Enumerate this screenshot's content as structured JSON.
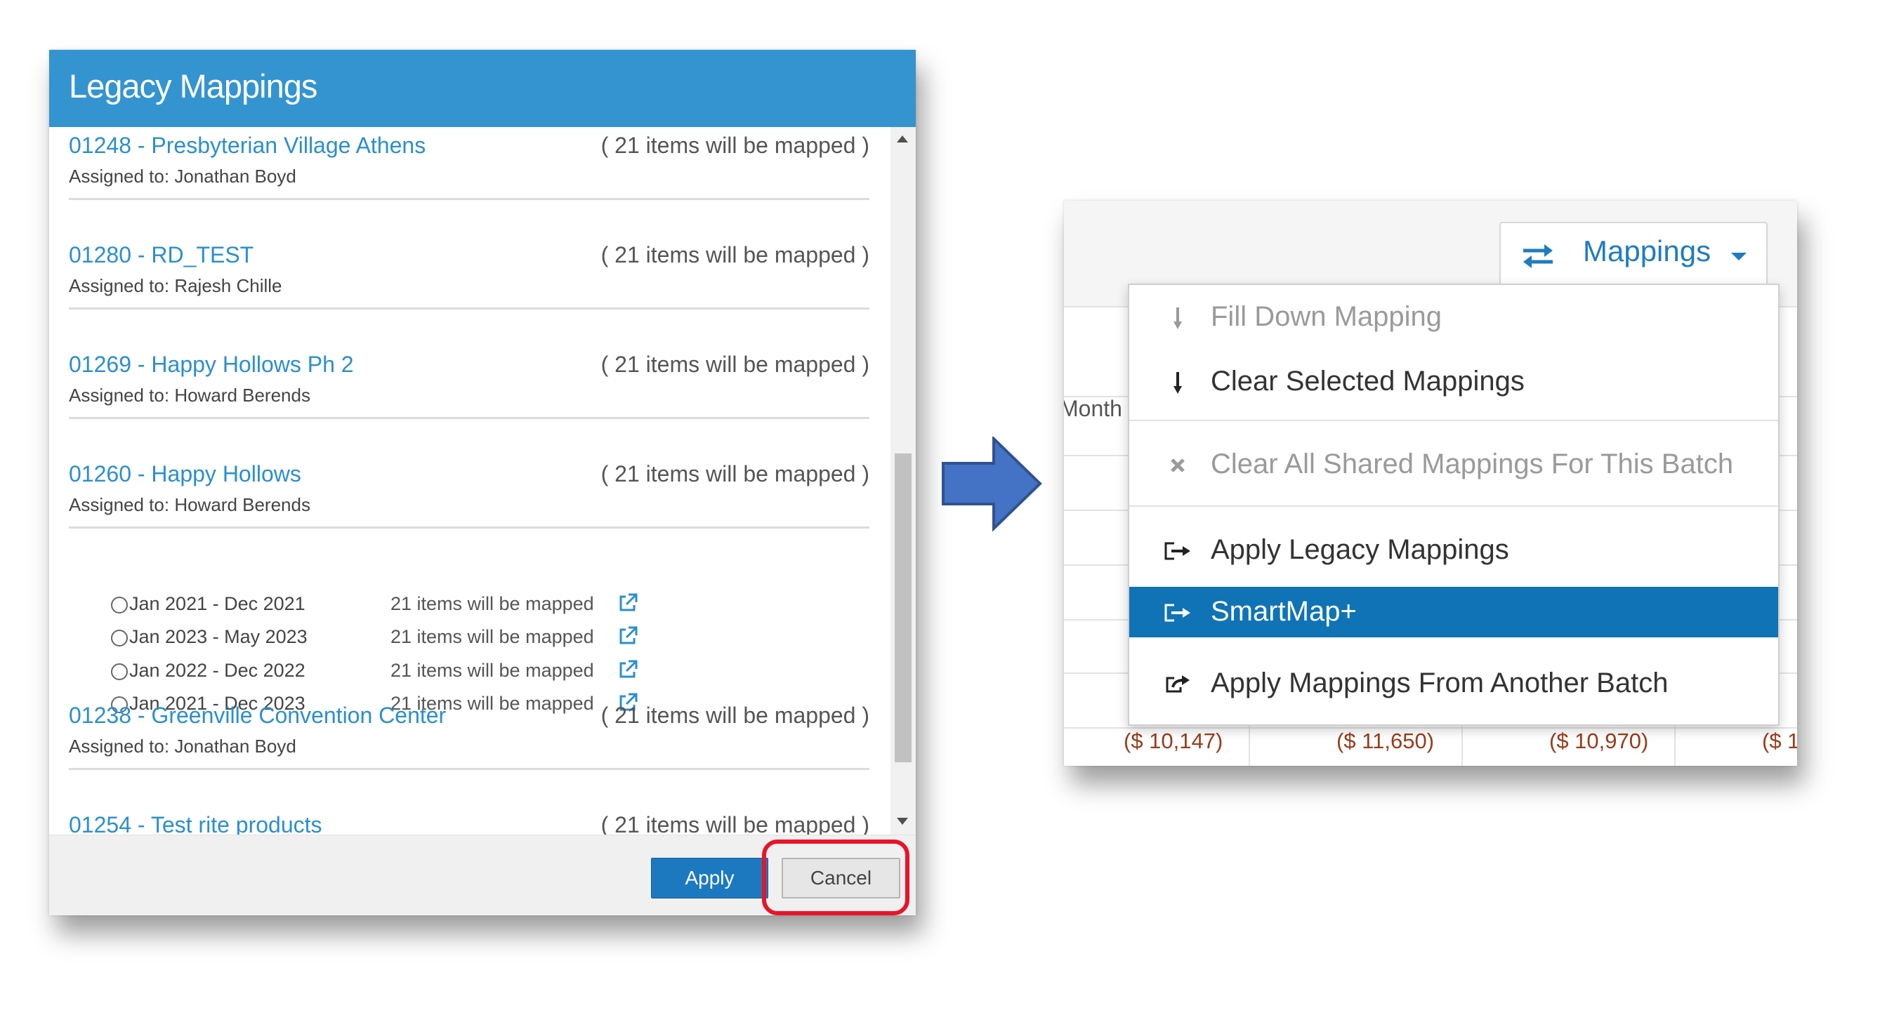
{
  "dialog": {
    "title": "Legacy Mappings",
    "entries": [
      {
        "name": "01248 - Presbyterian Village Athens",
        "count": "( 21 items will be mapped )",
        "assigned": "Assigned to: Jonathan Boyd"
      },
      {
        "name": "01280 - RD_TEST",
        "count": "( 21 items will be mapped )",
        "assigned": "Assigned to: Rajesh Chille"
      },
      {
        "name": "01269 - Happy Hollows Ph 2",
        "count": "( 21 items will be mapped )",
        "assigned": "Assigned to: Howard Berends"
      },
      {
        "name": "01260 - Happy Hollows",
        "count": "( 21 items will be mapped )",
        "assigned": "Assigned to: Howard Berends"
      },
      {
        "name": "01238 - Greenville Convention Center",
        "count": "( 21 items will be mapped )",
        "assigned": "Assigned to: Jonathan Boyd"
      },
      {
        "name": "01254 - Test rite products",
        "count": "( 21 items will be mapped )",
        "assigned": ""
      }
    ],
    "sub_options": [
      {
        "range": "Jan 2021 - Dec 2021",
        "count": "21 items will be mapped"
      },
      {
        "range": "Jan 2023 - May 2023",
        "count": "21 items will be mapped"
      },
      {
        "range": "Jan 2022 - Dec 2022",
        "count": "21 items will be mapped"
      },
      {
        "range": "Jan 2021 - Dec 2023",
        "count": "21 items will be mapped"
      }
    ],
    "apply_label": "Apply",
    "cancel_label": "Cancel"
  },
  "panel": {
    "mappings_label": "Mappings",
    "background_header": "Month",
    "background_values": [
      "($ 10,147)",
      "($ 11,650)",
      "($ 10,970)",
      "($ 1"
    ],
    "menu": [
      {
        "label": "Fill Down Mapping",
        "icon": "arrow-down-icon",
        "state": "disabled"
      },
      {
        "label": "Clear Selected Mappings",
        "icon": "arrow-down-icon",
        "state": "enabled"
      },
      {
        "label": "Clear All Shared Mappings For This Batch",
        "icon": "x-icon",
        "state": "disabled"
      },
      {
        "label": "Apply Legacy Mappings",
        "icon": "sign-in-icon",
        "state": "enabled"
      },
      {
        "label": "SmartMap+",
        "icon": "sign-in-icon",
        "state": "active"
      },
      {
        "label": "Apply Mappings From Another Batch",
        "icon": "share-icon",
        "state": "enabled"
      }
    ]
  },
  "colors": {
    "header_blue": "#3394d0",
    "link_blue": "#2a8fd0",
    "primary_button": "#1c79c0",
    "highlight_red": "#e8142a",
    "arrow_blue": "#4472c4",
    "menu_active": "#0f73b6"
  }
}
